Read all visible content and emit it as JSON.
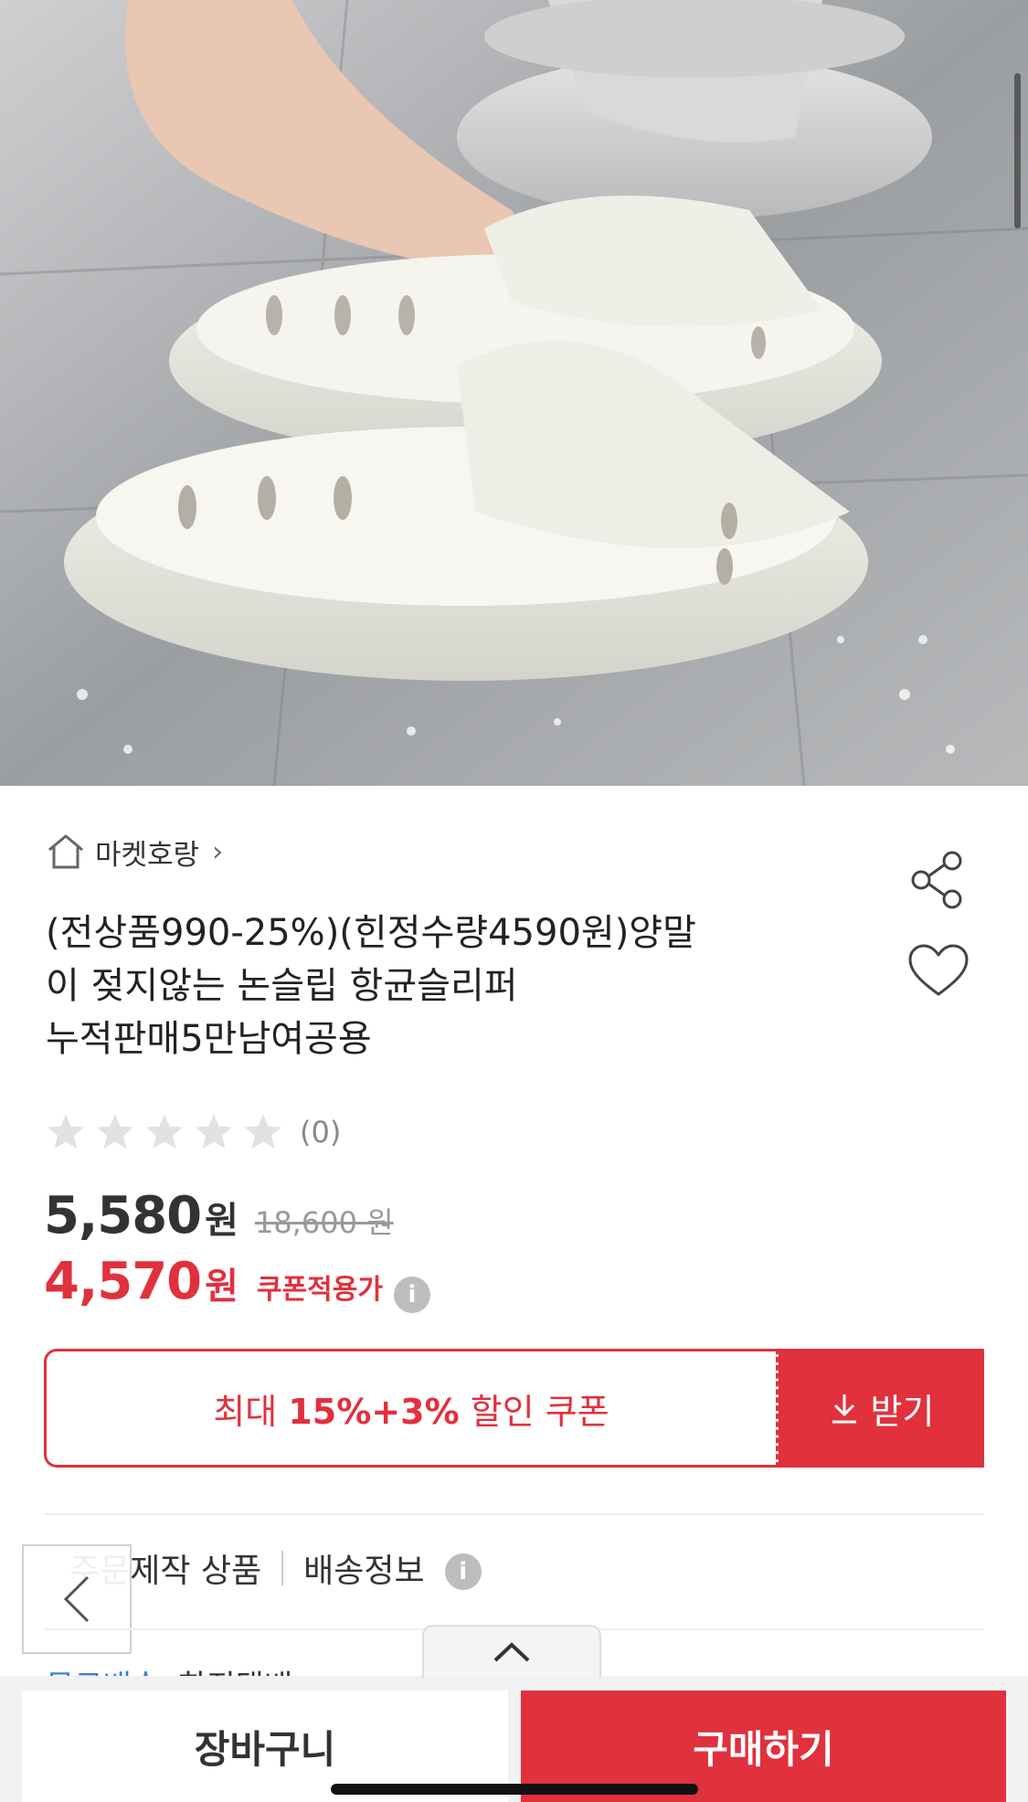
{
  "store": {
    "name": "마켓호랑",
    "chevron": "›"
  },
  "product": {
    "title_lines": [
      "(전상품990-25%)(힌정수량4590원)양말",
      "이 젖지않는 논슬립 항균슬리퍼",
      "누적판매5만남여공용"
    ]
  },
  "rating": {
    "stars": 0,
    "max_stars": 5,
    "count_text": "(0)"
  },
  "price": {
    "sale": "5,580",
    "sale_unit": "원",
    "original": "18,600 원",
    "coupon_price": "4,570",
    "coupon_unit": "원",
    "coupon_label": "쿠폰적용가"
  },
  "coupon": {
    "prefix": "최대 ",
    "highlight": "15%+3%",
    "suffix": " 할인 쿠폰",
    "get_label": "받기"
  },
  "info": {
    "made_to_order": "주문제작 상품",
    "shipping": "배송정보"
  },
  "peek": {
    "left": "무료배송",
    "right": "한진택배"
  },
  "actions": {
    "cart": "장바구니",
    "buy": "구매하기"
  },
  "colors": {
    "accent": "#e0313d",
    "text": "#222222",
    "muted": "#999999"
  },
  "icons": [
    "home-icon",
    "share-icon",
    "heart-icon",
    "star-icon",
    "info-icon",
    "download-icon",
    "back-chevron-icon",
    "expand-chevron-icon"
  ]
}
